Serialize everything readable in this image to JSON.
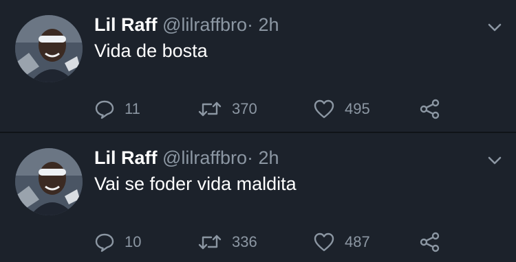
{
  "colors": {
    "background": "#1c222b",
    "divider": "#0f1318",
    "secondary_text": "#8c97a3",
    "primary_text": "#ffffff"
  },
  "tweets": [
    {
      "name": "Lil Raff",
      "handle": "@lilraffbro",
      "separator": "·",
      "time": "2h",
      "text": "Vida de bosta",
      "replies": "11",
      "retweets": "370",
      "likes": "495",
      "icons": [
        "reply-icon",
        "retweet-icon",
        "like-icon",
        "share-icon",
        "chevron-down-icon"
      ]
    },
    {
      "name": "Lil Raff",
      "handle": "@lilraffbro",
      "separator": "·",
      "time": "2h",
      "text": "Vai se foder vida maldita",
      "replies": "10",
      "retweets": "336",
      "likes": "487",
      "icons": [
        "reply-icon",
        "retweet-icon",
        "like-icon",
        "share-icon",
        "chevron-down-icon"
      ]
    }
  ]
}
